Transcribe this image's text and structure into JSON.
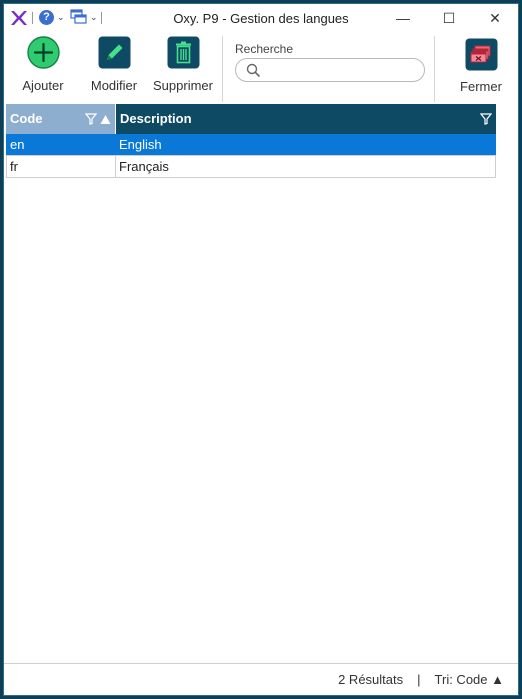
{
  "window": {
    "title": "Oxy. P9 - Gestion des langues",
    "minimize_glyph": "—",
    "maximize_glyph": "☐",
    "close_glyph": "✕"
  },
  "quick_access": {
    "logo_icon": "oxy-logo-icon",
    "help_icon": "help-icon",
    "help_glyph": "?",
    "windows_icon": "windows-icon",
    "chevron_glyph": "⌄"
  },
  "toolbar": {
    "add_label": "Ajouter",
    "edit_label": "Modifier",
    "delete_label": "Supprimer",
    "close_label": "Fermer"
  },
  "search": {
    "label": "Recherche",
    "value": "",
    "placeholder": ""
  },
  "grid": {
    "columns": [
      {
        "label": "Code"
      },
      {
        "label": "Description"
      }
    ],
    "rows": [
      {
        "code": "en",
        "description": "English"
      },
      {
        "code": "fr",
        "description": "Français"
      }
    ],
    "selected_row": 0
  },
  "status": {
    "results": "2 Résultats",
    "separator": "|",
    "sort": "Tri: Code ▲"
  },
  "colors": {
    "accent_dark": "#0f4a64",
    "header_sorted": "#8eaed0",
    "selection": "#0a78d7",
    "add_green": "#2ecc71"
  }
}
